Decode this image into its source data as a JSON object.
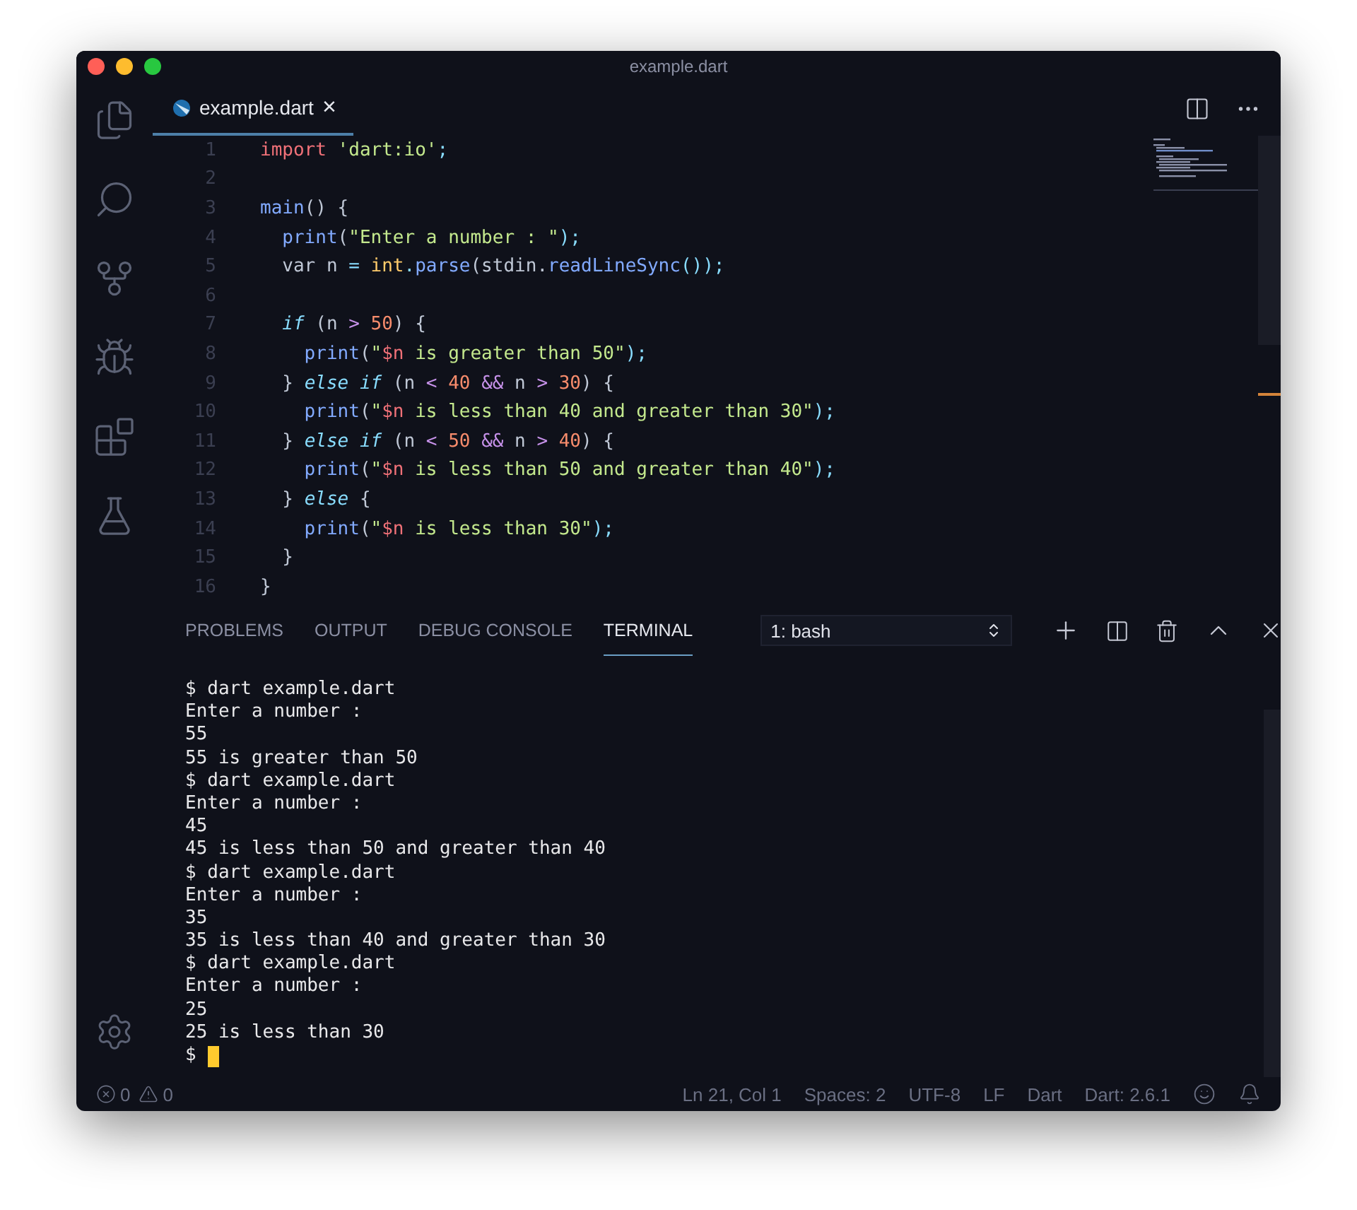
{
  "window": {
    "title": "example.dart"
  },
  "editor_tabs": [
    {
      "label": "example.dart",
      "selected": true,
      "close": "×"
    }
  ],
  "code_lines": [
    {
      "number": "1",
      "tokens": [
        {
          "text": "import ",
          "kind": "keyword"
        },
        {
          "text": "'dart:io'",
          "kind": "string"
        },
        {
          "text": ";",
          "kind": "punct"
        }
      ]
    },
    {
      "number": "2"
    },
    {
      "number": "3",
      "tokens": [
        {
          "text": "main",
          "kind": "function"
        },
        {
          "text": "() {",
          "kind": "plain"
        }
      ]
    },
    {
      "number": "4",
      "tokens": [
        {
          "text": "  print",
          "kind": "function"
        },
        {
          "text": "(",
          "kind": "plain"
        },
        {
          "text": "\"Enter a number : \"",
          "kind": "string"
        },
        {
          "text": ");",
          "kind": "punct"
        }
      ]
    },
    {
      "number": "5",
      "tokens": [
        {
          "text": "  var n ",
          "kind": "plain"
        },
        {
          "text": "= ",
          "kind": "punct"
        },
        {
          "text": "int",
          "kind": "type"
        },
        {
          "text": ".",
          "kind": "punct"
        },
        {
          "text": "parse",
          "kind": "function"
        },
        {
          "text": "(stdin.",
          "kind": "plain"
        },
        {
          "text": "readLineSync",
          "kind": "function"
        },
        {
          "text": "());",
          "kind": "punct"
        }
      ]
    },
    {
      "number": "6"
    },
    {
      "number": "7",
      "tokens": [
        {
          "text": "  if",
          "kind": "control"
        },
        {
          "text": " (n ",
          "kind": "plain"
        },
        {
          "text": "> ",
          "kind": "operator"
        },
        {
          "text": "50",
          "kind": "number"
        },
        {
          "text": ") {",
          "kind": "plain"
        }
      ]
    },
    {
      "number": "8",
      "tokens": [
        {
          "text": "    print",
          "kind": "function"
        },
        {
          "text": "(",
          "kind": "plain"
        },
        {
          "text": "\"",
          "kind": "string"
        },
        {
          "text": "$n",
          "kind": "interp"
        },
        {
          "text": " is greater than 50\"",
          "kind": "string"
        },
        {
          "text": ");",
          "kind": "punct"
        }
      ]
    },
    {
      "number": "9",
      "tokens": [
        {
          "text": "  } ",
          "kind": "plain"
        },
        {
          "text": "else if",
          "kind": "control"
        },
        {
          "text": " (n ",
          "kind": "plain"
        },
        {
          "text": "< ",
          "kind": "operator"
        },
        {
          "text": "40 ",
          "kind": "number"
        },
        {
          "text": "&& ",
          "kind": "operator"
        },
        {
          "text": "n ",
          "kind": "plain"
        },
        {
          "text": "> ",
          "kind": "operator"
        },
        {
          "text": "30",
          "kind": "number"
        },
        {
          "text": ") {",
          "kind": "plain"
        }
      ]
    },
    {
      "number": "10",
      "tokens": [
        {
          "text": "    print",
          "kind": "function"
        },
        {
          "text": "(",
          "kind": "plain"
        },
        {
          "text": "\"",
          "kind": "string"
        },
        {
          "text": "$n",
          "kind": "interp"
        },
        {
          "text": " is less than 40 and greater than 30\"",
          "kind": "string"
        },
        {
          "text": ");",
          "kind": "punct"
        }
      ]
    },
    {
      "number": "11",
      "tokens": [
        {
          "text": "  } ",
          "kind": "plain"
        },
        {
          "text": "else if",
          "kind": "control"
        },
        {
          "text": " (n ",
          "kind": "plain"
        },
        {
          "text": "< ",
          "kind": "operator"
        },
        {
          "text": "50 ",
          "kind": "number"
        },
        {
          "text": "&& ",
          "kind": "operator"
        },
        {
          "text": "n ",
          "kind": "plain"
        },
        {
          "text": "> ",
          "kind": "operator"
        },
        {
          "text": "40",
          "kind": "number"
        },
        {
          "text": ") {",
          "kind": "plain"
        }
      ]
    },
    {
      "number": "12",
      "tokens": [
        {
          "text": "    print",
          "kind": "function"
        },
        {
          "text": "(",
          "kind": "plain"
        },
        {
          "text": "\"",
          "kind": "string"
        },
        {
          "text": "$n",
          "kind": "interp"
        },
        {
          "text": " is less than 50 and greater than 40\"",
          "kind": "string"
        },
        {
          "text": ");",
          "kind": "punct"
        }
      ]
    },
    {
      "number": "13",
      "tokens": [
        {
          "text": "  } ",
          "kind": "plain"
        },
        {
          "text": "else",
          "kind": "control"
        },
        {
          "text": " {",
          "kind": "plain"
        }
      ]
    },
    {
      "number": "14",
      "tokens": [
        {
          "text": "    print",
          "kind": "function"
        },
        {
          "text": "(",
          "kind": "plain"
        },
        {
          "text": "\"",
          "kind": "string"
        },
        {
          "text": "$n",
          "kind": "interp"
        },
        {
          "text": " is less than 30\"",
          "kind": "string"
        },
        {
          "text": ");",
          "kind": "punct"
        }
      ]
    },
    {
      "number": "15",
      "tokens": [
        {
          "text": "  }",
          "kind": "plain"
        }
      ]
    },
    {
      "number": "16",
      "tokens": [
        {
          "text": "}",
          "kind": "plain"
        }
      ]
    }
  ],
  "panel_tabs": [
    {
      "label": "PROBLEMS",
      "selected": false
    },
    {
      "label": "OUTPUT",
      "selected": false
    },
    {
      "label": "DEBUG CONSOLE",
      "selected": false
    },
    {
      "label": "TERMINAL",
      "selected": true
    }
  ],
  "terminal_select": {
    "value": "1: bash"
  },
  "terminal_lines": [
    "$ dart example.dart",
    "Enter a number :",
    "55",
    "55 is greater than 50",
    "$ dart example.dart",
    "Enter a number :",
    "45",
    "45 is less than 50 and greater than 40",
    "$ dart example.dart",
    "Enter a number :",
    "35",
    "35 is less than 40 and greater than 30",
    "$ dart example.dart",
    "Enter a number :",
    "25",
    "25 is less than 30"
  ],
  "prompt": "$",
  "status_bar": {
    "errors": "0",
    "warnings": "0",
    "items": [
      "Ln 21, Col 1",
      "Spaces: 2",
      "UTF-8",
      "LF",
      "Dart",
      "Dart: 2.6.1"
    ]
  }
}
